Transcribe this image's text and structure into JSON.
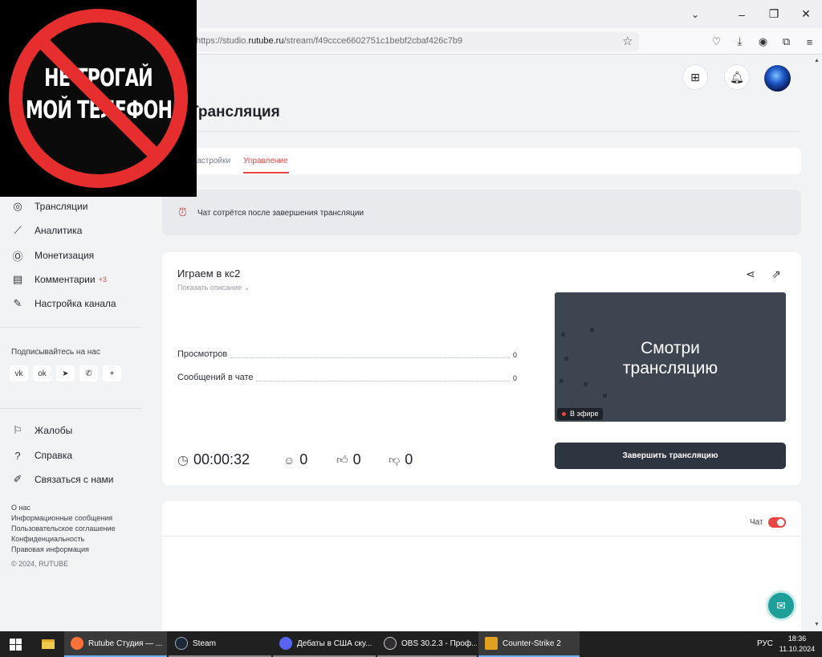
{
  "browser": {
    "url_prefix": "https://studio.",
    "url_domain": "rutube.ru",
    "url_path": "/stream/f49ccce6602751c1bebf2cbaf426c7b9",
    "tab_list_icon": "chevron-down-icon",
    "window_controls": {
      "minimize": "–",
      "restore": "❐",
      "close": "✕"
    },
    "toolbar_icons": [
      "pocket-icon",
      "download-icon",
      "account-icon",
      "extensions-icon",
      "menu-icon"
    ]
  },
  "overlay": {
    "line1": "НЕ ТРОГАЙ",
    "line2": "МОЙ ТЕЛЕФОН"
  },
  "page": {
    "title": "Трансляция",
    "tabs": [
      {
        "label": "Настройки"
      },
      {
        "label": "Управление",
        "active": true
      }
    ],
    "notice": "Чат сотрётся после завершения трансляции"
  },
  "sidebar": {
    "items": [
      {
        "label": "Трансляции",
        "icon": "broadcast-icon"
      },
      {
        "label": "Аналитика",
        "icon": "chart-line-icon"
      },
      {
        "label": "Монетизация",
        "icon": "coin-icon"
      },
      {
        "label": "Комментарии",
        "icon": "comment-icon",
        "badge": "+3"
      },
      {
        "label": "Настройка канала",
        "icon": "magic-wand-icon"
      }
    ],
    "subscribe_label": "Подписывайтесь на нас",
    "socials": [
      "vk-icon",
      "ok-icon",
      "telegram-icon",
      "viber-icon",
      "plus-icon"
    ],
    "social_glyphs": [
      "vk",
      "ok",
      "➤",
      "✆",
      "+"
    ],
    "help_items": [
      {
        "label": "Жалобы",
        "icon": "flag-icon"
      },
      {
        "label": "Справка",
        "icon": "question-icon"
      },
      {
        "label": "Связаться с нами",
        "icon": "pencil-icon"
      }
    ],
    "footer_links": [
      "О нас",
      "Информационные сообщения",
      "Пользовательское соглашение",
      "Конфиденциальность",
      "Правовая информация"
    ],
    "copyright": "© 2024, RUTUBE"
  },
  "stream": {
    "title": "Играем в кс2",
    "show_description": "Показать описание",
    "stats": [
      {
        "label": "Просмотров",
        "value": "0"
      },
      {
        "label": "Сообщений в чате",
        "value": "0"
      }
    ],
    "duration": "00:00:32",
    "viewers": "0",
    "likes": "0",
    "dislikes": "0",
    "preview_text_line1": "Смотри",
    "preview_text_line2": "трансляцию",
    "live_badge": "В эфире",
    "end_button": "Завершить трансляцию"
  },
  "chat": {
    "label": "Чат",
    "enabled": true
  },
  "taskbar": {
    "tasks": [
      {
        "label": "Rutube Студия — ...",
        "icon": "firefox-icon",
        "color": "#ff7139",
        "state": "active"
      },
      {
        "label": "Steam",
        "icon": "steam-icon",
        "color": "#1b2838",
        "state": "open"
      },
      {
        "label": "Дебаты в США ску...",
        "icon": "discord-icon",
        "color": "#5865f2",
        "state": "open"
      },
      {
        "label": "OBS 30.2.3 - Проф...",
        "icon": "obs-icon",
        "color": "#302e31",
        "state": "open"
      },
      {
        "label": "Counter-Strike 2",
        "icon": "cs2-icon",
        "color": "#e0a020",
        "state": "active"
      }
    ],
    "language": "РУС",
    "time": "18:36",
    "date": "11.10.2024"
  },
  "colors": {
    "accent": "#e84545",
    "dark_button": "#2d3540",
    "support": "#1e9f9a"
  }
}
